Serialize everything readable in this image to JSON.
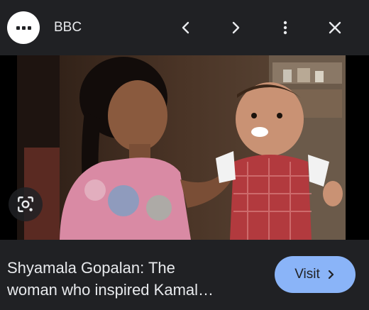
{
  "header": {
    "source_name": "BBC",
    "icons": [
      "source-logo-icon",
      "chevron-left-icon",
      "chevron-right-icon",
      "more-vert-icon",
      "close-icon"
    ]
  },
  "image": {
    "lens_icon": "lens-search-icon"
  },
  "footer": {
    "caption_line1": "Shyamala Gopalan: The",
    "caption_line2": "woman who inspired Kamal…",
    "visit_label": "Visit"
  },
  "colors": {
    "background": "#202124",
    "accent": "#8ab4f8",
    "text": "#e8eaed"
  }
}
